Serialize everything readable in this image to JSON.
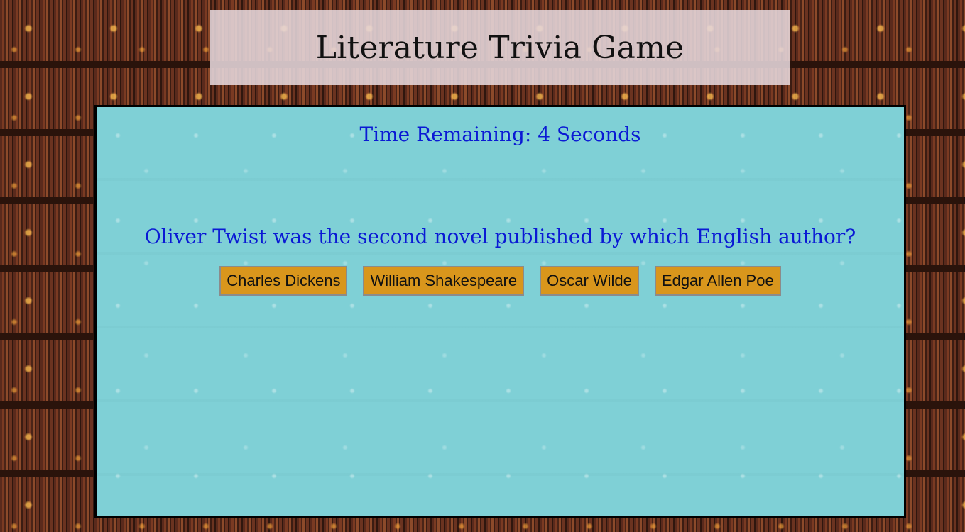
{
  "header": {
    "title": "Literature Trivia Game"
  },
  "game": {
    "timer_text": "Time Remaining: 4 Seconds",
    "question": "Oliver Twist was the second novel published by which English author?",
    "answers": [
      "Charles Dickens",
      "William Shakespeare",
      "Oscar Wilde",
      "Edgar Allen Poe"
    ]
  },
  "colors": {
    "panel_background": "#7fd0d6",
    "text_blue": "#0a19d4",
    "button_orange": "#d9961c",
    "header_background": "#e6d7dc"
  }
}
